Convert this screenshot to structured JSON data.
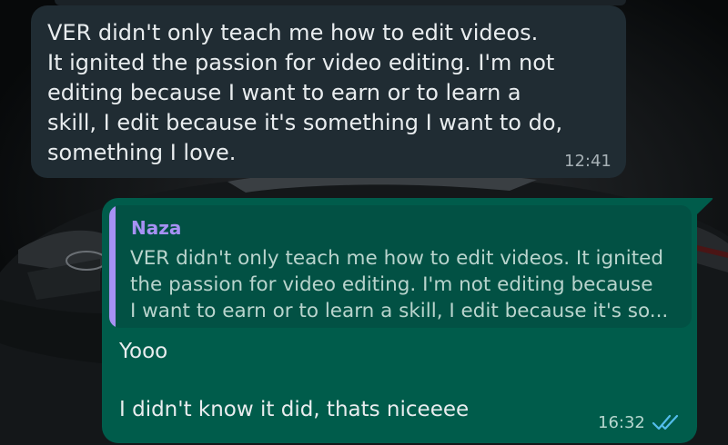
{
  "incoming_message": {
    "lines": [
      "VER didn't only teach me how to edit videos.",
      "It ignited the passion for video editing. I'm not",
      "editing because I want to earn or to learn a",
      "skill, I edit because it's something I want to do,",
      "something I love."
    ],
    "time": "12:41"
  },
  "outgoing_message": {
    "quoted": {
      "sender": "Naza",
      "lines": [
        "VER didn't only teach me how to edit videos. It ignited",
        "the passion for video editing. I'm not editing because",
        "I want to earn or to learn a skill, I edit because it's so..."
      ]
    },
    "text_line1": "Yooo",
    "text_line2": "I didn't know it did, thats niceeee",
    "time": "16:32",
    "status_icon": "double-check-read-icon"
  },
  "colors": {
    "incoming_bubble": "#202c33",
    "outgoing_bubble": "#005c4b",
    "quote_accent": "#a791f4",
    "read_receipt": "#53bdeb"
  }
}
